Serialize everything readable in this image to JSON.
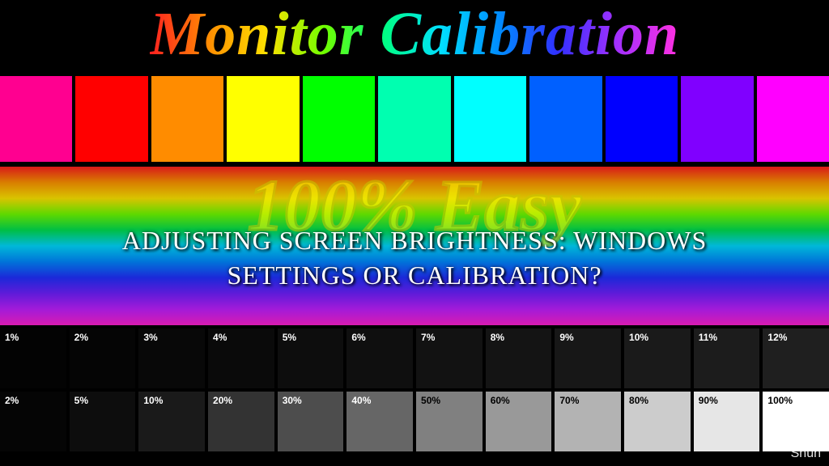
{
  "title": "Monitor Calibration",
  "swatches": [
    "#ff0090",
    "#ff0000",
    "#ff8c00",
    "#ffff00",
    "#00ff00",
    "#00ffb0",
    "#00ffff",
    "#0060ff",
    "#0000ff",
    "#8000ff",
    "#ff00ff"
  ],
  "easy_text": "100% Easy",
  "caption_line1": "ADJUSTING SCREEN BRIGHTNESS: WINDOWS",
  "caption_line2": "SETTINGS OR CALIBRATION?",
  "gray_row1": {
    "labels": [
      "1%",
      "2%",
      "3%",
      "4%",
      "5%",
      "6%",
      "7%",
      "8%",
      "9%",
      "10%",
      "11%",
      "12%"
    ],
    "values": [
      1,
      2,
      3,
      4,
      5,
      6,
      7,
      8,
      9,
      10,
      11,
      12
    ]
  },
  "gray_row2": {
    "labels": [
      "2%",
      "5%",
      "10%",
      "20%",
      "30%",
      "40%",
      "50%",
      "60%",
      "70%",
      "80%",
      "90%",
      "100%"
    ],
    "values": [
      2,
      5,
      10,
      20,
      30,
      40,
      50,
      60,
      70,
      80,
      90,
      100
    ]
  },
  "watermark": "Shun"
}
